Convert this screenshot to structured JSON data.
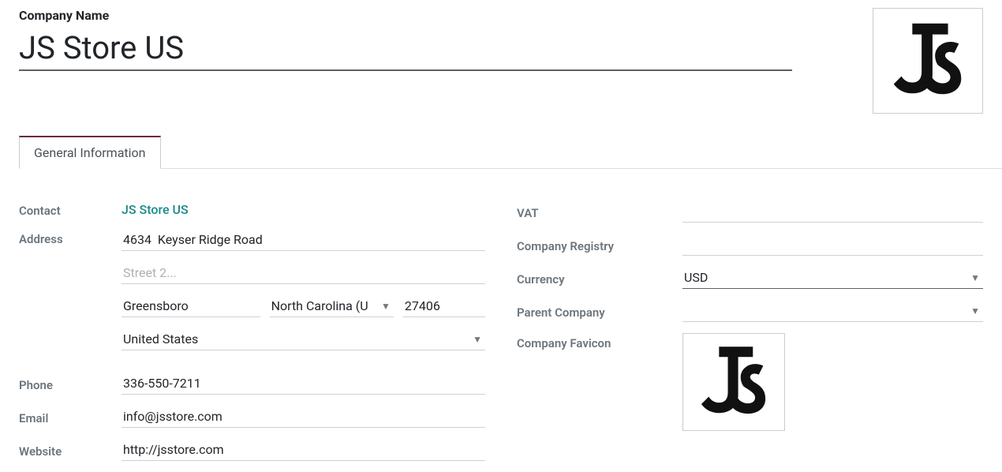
{
  "header": {
    "label": "Company Name",
    "value": "JS Store US"
  },
  "tabs": {
    "general": "General Information"
  },
  "left": {
    "contact_label": "Contact",
    "contact_value": "JS Store US",
    "address_label": "Address",
    "street1": "4634  Keyser Ridge Road",
    "street2_placeholder": "Street 2...",
    "city": "Greensboro",
    "state": "North Carolina (U",
    "zip": "27406",
    "country": "United States",
    "phone_label": "Phone",
    "phone": "336-550-7211",
    "email_label": "Email",
    "email": "info@jsstore.com",
    "website_label": "Website",
    "website": "http://jsstore.com"
  },
  "right": {
    "vat_label": "VAT",
    "vat_value": "",
    "registry_label": "Company Registry",
    "registry_value": "",
    "currency_label": "Currency",
    "currency_value": "USD",
    "parent_label": "Parent Company",
    "parent_value": "",
    "favicon_label": "Company Favicon"
  }
}
